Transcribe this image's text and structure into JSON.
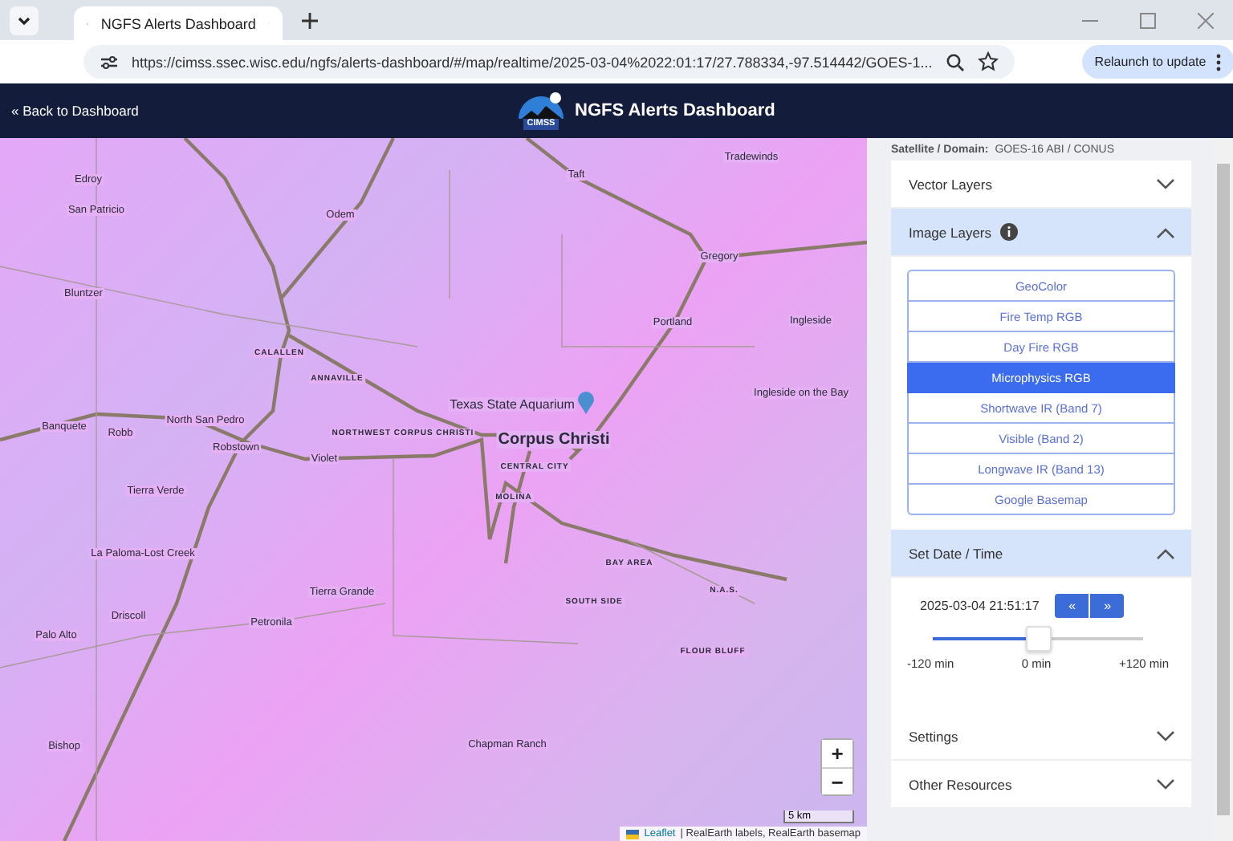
{
  "browser": {
    "tab_title": "NGFS Alerts Dashboard",
    "url": "https://cimss.ssec.wisc.edu/ngfs/alerts-dashboard/#/map/realtime/2025-03-04%2022:01:17/27.788334,-97.514442/GOES-1...",
    "relaunch_button": "Relaunch to update"
  },
  "header": {
    "back_link": "« Back to Dashboard",
    "logo_text": "CIMSS",
    "title": "NGFS Alerts Dashboard"
  },
  "map": {
    "places": [
      {
        "name": "Edroy",
        "kind": "town"
      },
      {
        "name": "Odem",
        "kind": "town"
      },
      {
        "name": "Taft",
        "kind": "town"
      },
      {
        "name": "Tradewinds",
        "kind": "town"
      },
      {
        "name": "San Patricio",
        "kind": "town"
      },
      {
        "name": "Gregory",
        "kind": "town"
      },
      {
        "name": "Bluntzer",
        "kind": "town"
      },
      {
        "name": "Portland",
        "kind": "town"
      },
      {
        "name": "Ingleside",
        "kind": "town"
      },
      {
        "name": "CALALLEN",
        "kind": "district"
      },
      {
        "name": "ANNAVILLE",
        "kind": "district"
      },
      {
        "name": "Texas State Aquarium",
        "kind": "landmark"
      },
      {
        "name": "Ingleside on the Bay",
        "kind": "town"
      },
      {
        "name": "Banquete",
        "kind": "town"
      },
      {
        "name": "Robb",
        "kind": "town"
      },
      {
        "name": "North San Pedro",
        "kind": "town"
      },
      {
        "name": "Robstown",
        "kind": "town"
      },
      {
        "name": "NORTHWEST CORPUS CHRISTI",
        "kind": "district"
      },
      {
        "name": "Violet",
        "kind": "town"
      },
      {
        "name": "Corpus Christi",
        "kind": "city"
      },
      {
        "name": "CENTRAL CITY",
        "kind": "district"
      },
      {
        "name": "Tierra Verde",
        "kind": "town"
      },
      {
        "name": "MOLINA",
        "kind": "district"
      },
      {
        "name": "La Paloma-Lost Creek",
        "kind": "town"
      },
      {
        "name": "BAY AREA",
        "kind": "district"
      },
      {
        "name": "Tierra Grande",
        "kind": "town"
      },
      {
        "name": "Driscoll",
        "kind": "town"
      },
      {
        "name": "Petronila",
        "kind": "town"
      },
      {
        "name": "SOUTH SIDE",
        "kind": "district"
      },
      {
        "name": "N.A.S.",
        "kind": "district"
      },
      {
        "name": "Palo Alto",
        "kind": "town"
      },
      {
        "name": "FLOUR BLUFF",
        "kind": "district"
      },
      {
        "name": "Bishop",
        "kind": "town"
      },
      {
        "name": "Chapman Ranch",
        "kind": "town"
      }
    ],
    "zoom_in": "+",
    "zoom_out": "−",
    "scale": "5 km",
    "attribution_link": "Leaflet",
    "attribution": "| RealEarth labels, RealEarth basemap"
  },
  "sidebar": {
    "satellite_label": "Satellite / Domain:",
    "satellite_value": "GOES-16 ABI / CONUS",
    "sections": [
      {
        "title": "Vector Layers",
        "kind": "plain",
        "expanded": false
      },
      {
        "title": "Image Layers",
        "kind": "layers",
        "expanded": true,
        "layers": [
          {
            "label": "GeoColor",
            "selected": false
          },
          {
            "label": "Fire Temp RGB",
            "selected": false
          },
          {
            "label": "Day Fire RGB",
            "selected": false
          },
          {
            "label": "Microphysics RGB",
            "selected": true
          },
          {
            "label": "Shortwave IR (Band 7)",
            "selected": false
          },
          {
            "label": "Visible (Band 2)",
            "selected": false
          },
          {
            "label": "Longwave IR (Band 13)",
            "selected": false
          },
          {
            "label": "Google Basemap",
            "selected": false
          }
        ]
      },
      {
        "title": "Set Date / Time",
        "kind": "datetime",
        "expanded": true,
        "datetime": "2025-03-04 21:51:17",
        "prev": "«",
        "next": "»",
        "slider": {
          "level": 0.5,
          "min_label": "-120 min",
          "mid_label": "0 min",
          "max_label": "+120 min"
        }
      },
      {
        "title": "Settings",
        "kind": "plain",
        "expanded": false
      },
      {
        "title": "Other Resources",
        "kind": "plain",
        "expanded": false
      }
    ]
  }
}
